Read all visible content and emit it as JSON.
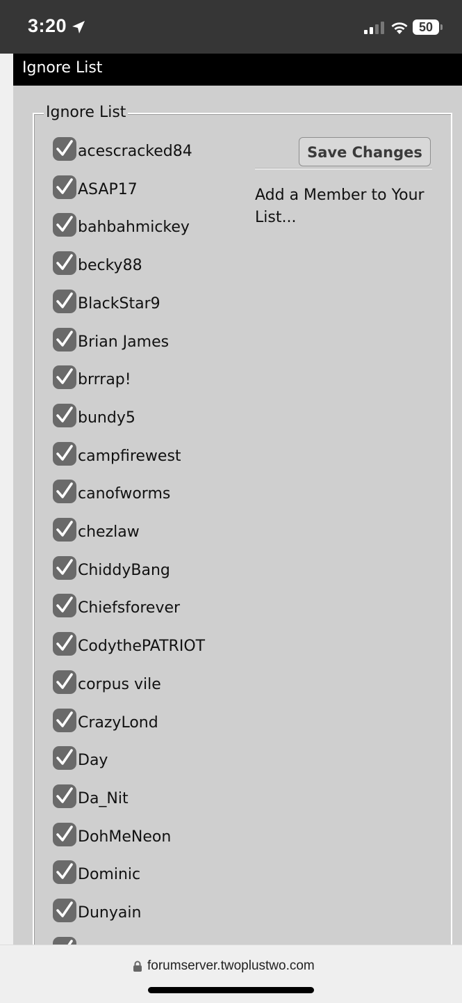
{
  "status_bar": {
    "time": "3:20",
    "battery": "50"
  },
  "page": {
    "header_title": "Ignore List",
    "legend": "Ignore List",
    "save_label": "Save Changes",
    "add_member_label": "Add a Member to Your List..."
  },
  "members": [
    {
      "name": "acescracked84",
      "checked": true
    },
    {
      "name": "ASAP17",
      "checked": true
    },
    {
      "name": "bahbahmickey",
      "checked": true
    },
    {
      "name": "becky88",
      "checked": true
    },
    {
      "name": "BlackStar9",
      "checked": true
    },
    {
      "name": "Brian James",
      "checked": true
    },
    {
      "name": "brrrap!",
      "checked": true
    },
    {
      "name": "bundy5",
      "checked": true
    },
    {
      "name": "campfirewest",
      "checked": true
    },
    {
      "name": "canofworms",
      "checked": true
    },
    {
      "name": "chezlaw",
      "checked": true
    },
    {
      "name": "ChiddyBang",
      "checked": true
    },
    {
      "name": "Chiefsforever",
      "checked": true
    },
    {
      "name": "CodythePATRIOT",
      "checked": true
    },
    {
      "name": "corpus vile",
      "checked": true
    },
    {
      "name": "CrazyLond",
      "checked": true
    },
    {
      "name": "Day",
      "checked": true
    },
    {
      "name": "Da_Nit",
      "checked": true
    },
    {
      "name": "DohMeNeon",
      "checked": true
    },
    {
      "name": "Dominic",
      "checked": true
    },
    {
      "name": "Dunyain",
      "checked": true
    },
    {
      "name": "",
      "checked": true
    }
  ],
  "browser": {
    "url": "forumserver.twoplustwo.com"
  },
  "icons": {
    "location": "location-arrow-icon",
    "signal": "cellular-signal-icon",
    "wifi": "wifi-icon",
    "battery": "battery-icon",
    "checkbox": "checkmark-icon",
    "lock": "lock-icon"
  }
}
